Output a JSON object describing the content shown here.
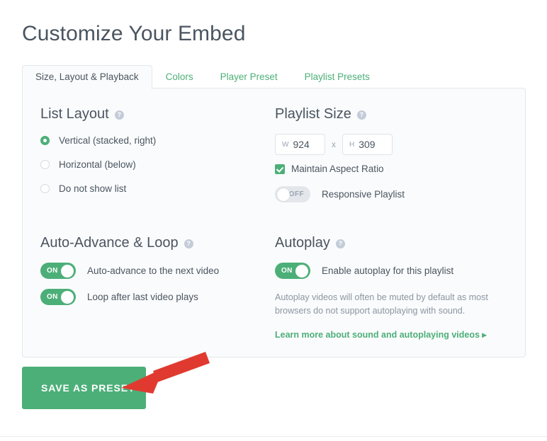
{
  "header": {
    "title": "Customize Your Embed"
  },
  "tabs": [
    {
      "label": "Size, Layout & Playback",
      "active": true
    },
    {
      "label": "Colors",
      "active": false
    },
    {
      "label": "Player Preset",
      "active": false
    },
    {
      "label": "Playlist Presets",
      "active": false
    }
  ],
  "help_glyph": "?",
  "sections": {
    "list_layout": {
      "title": "List Layout",
      "options": [
        {
          "label": "Vertical (stacked, right)",
          "selected": true
        },
        {
          "label": "Horizontal (below)",
          "selected": false
        },
        {
          "label": "Do not show list",
          "selected": false
        }
      ]
    },
    "playlist_size": {
      "title": "Playlist Size",
      "width": {
        "prefix": "W",
        "value": "924"
      },
      "separator": "x",
      "height": {
        "prefix": "H",
        "value": "309"
      },
      "maintain_aspect_ratio": {
        "label": "Maintain Aspect Ratio",
        "checked": true
      },
      "responsive": {
        "label": "Responsive Playlist",
        "state": "OFF"
      }
    },
    "auto_advance": {
      "title": "Auto-Advance & Loop",
      "toggles": [
        {
          "state": "ON",
          "label": "Auto-advance to the next video"
        },
        {
          "state": "ON",
          "label": "Loop after last video plays"
        }
      ]
    },
    "autoplay": {
      "title": "Autoplay",
      "toggle": {
        "state": "ON",
        "label": "Enable autoplay for this playlist"
      },
      "note": "Autoplay videos will often be muted by default as most browsers do not support autoplaying with sound.",
      "learn_more": "Learn more about sound and autoplaying videos ▸"
    }
  },
  "footer": {
    "save_button": "SAVE AS PRESET"
  },
  "colors": {
    "accent_green": "#4caf78",
    "arrow_red": "#e03a30",
    "text_dark": "#4a5560",
    "text_muted": "#8b96a2",
    "card_bg": "#fafbfc",
    "border": "#e4e8ec"
  }
}
